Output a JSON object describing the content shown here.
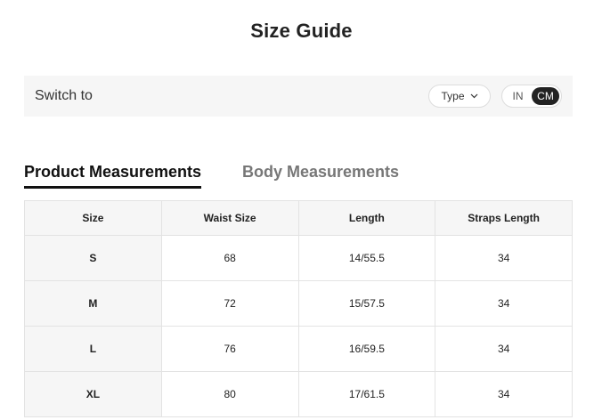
{
  "title": "Size Guide",
  "switch_bar": {
    "label": "Switch to",
    "type_button": "Type",
    "units": [
      "IN",
      "CM"
    ],
    "active_unit": "CM"
  },
  "tabs": [
    {
      "label": "Product Measurements",
      "active": true
    },
    {
      "label": "Body Measurements",
      "active": false
    }
  ],
  "table": {
    "headers": [
      "Size",
      "Waist Size",
      "Length",
      "Straps Length"
    ],
    "rows": [
      [
        "S",
        "68",
        "14/55.5",
        "34"
      ],
      [
        "M",
        "72",
        "15/57.5",
        "34"
      ],
      [
        "L",
        "76",
        "16/59.5",
        "34"
      ],
      [
        "XL",
        "80",
        "17/61.5",
        "34"
      ]
    ]
  },
  "colors": {
    "text": "#222222",
    "panel_bg": "#f6f6f6",
    "active_toggle": "#222222",
    "inactive_tab": "#777777"
  }
}
